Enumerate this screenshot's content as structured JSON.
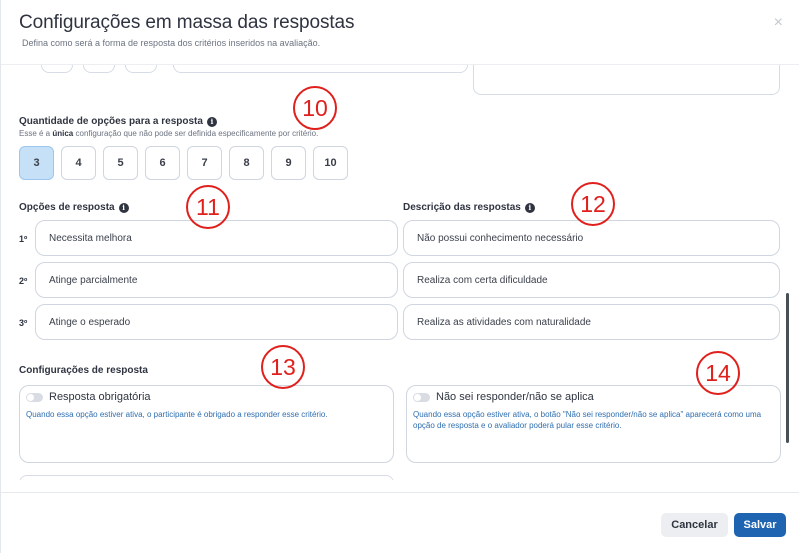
{
  "modal": {
    "title": "Configurações em massa das respostas",
    "subtitle": "Defina como será a forma de resposta dos critérios inseridos na avaliação.",
    "close_icon": "×"
  },
  "quantity": {
    "label": "Quantidade de opções para a resposta",
    "helper_prefix": "Esse é a ",
    "helper_bold": "única",
    "helper_suffix": " configuração que não pode ser definida especificamente por critério.",
    "options": [
      "3",
      "4",
      "5",
      "6",
      "7",
      "8",
      "9",
      "10"
    ],
    "selected": "3"
  },
  "response_options": {
    "label": "Opções de resposta",
    "items": [
      {
        "num": "1º",
        "value": "Necessita melhora"
      },
      {
        "num": "2º",
        "value": "Atinge parcialmente"
      },
      {
        "num": "3º",
        "value": "Atinge o esperado"
      }
    ]
  },
  "descriptions": {
    "label": "Descrição das respostas",
    "items": [
      "Não possui conhecimento necessário",
      "Realiza com certa dificuldade",
      "Realiza as atividades com naturalidade"
    ]
  },
  "response_config": {
    "label": "Configurações de resposta",
    "cards": [
      {
        "toggle_label": "Resposta obrigatória",
        "description": "Quando essa opção estiver ativa, o participante é obrigado a responder esse critério.",
        "enabled": false
      },
      {
        "toggle_label": "Não sei responder/não se aplica",
        "description": "Quando essa opção estiver ativa, o botão \"Não sei responder/não se aplica\" aparecerá como uma opção de resposta e o avaliador poderá pular esse critério.",
        "enabled": false
      }
    ]
  },
  "annotations": [
    "10",
    "11",
    "12",
    "13",
    "14"
  ],
  "footer": {
    "cancel_label": "Cancelar",
    "save_label": "Salvar"
  },
  "colors": {
    "selected_option_bg": "#c6e0f7",
    "primary_button": "#1f64b0",
    "annotation_red": "#e0201c",
    "description_blue": "#2f6fb0"
  }
}
